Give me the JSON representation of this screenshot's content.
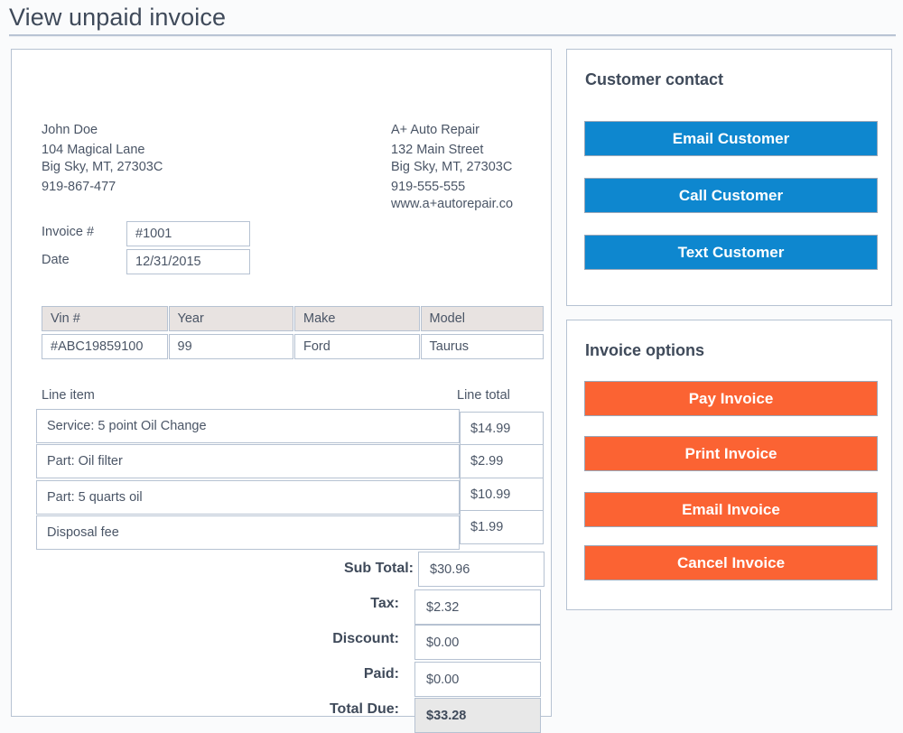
{
  "page": {
    "title": "View unpaid invoice"
  },
  "invoice": {
    "customer": {
      "name": "John Doe",
      "street": "104 Magical Lane",
      "city_state_zip": "Big Sky, MT, 27303C",
      "phone": "919-867-477"
    },
    "business": {
      "name": "A+ Auto Repair",
      "street": "132 Main Street",
      "city_state_zip": "Big Sky, MT, 27303C",
      "phone": "919-555-555",
      "website": "www.a+autorepair.co"
    },
    "meta": [
      {
        "label": "Invoice #",
        "value": "#1001"
      },
      {
        "label": "Date",
        "value": "12/31/2015"
      }
    ],
    "vehicle": {
      "headers": [
        "Vin #",
        "Year",
        "Make",
        "Model"
      ],
      "row": [
        "#ABC19859100",
        "99",
        "Ford",
        "Taurus"
      ]
    },
    "line_items": {
      "header_item": "Line item",
      "header_total": "Line total",
      "rows": [
        {
          "description": "Service: 5 point Oil Change",
          "amount": "$14.99"
        },
        {
          "description": "Part: Oil filter",
          "amount": "$2.99"
        },
        {
          "description": "Part: 5 quarts oil",
          "amount": "$10.99"
        },
        {
          "description": "Disposal fee",
          "amount": "$1.99"
        }
      ]
    },
    "totals": [
      {
        "label": "Sub Total:",
        "value": "$30.96"
      },
      {
        "label": "Tax:",
        "value": "$2.32"
      },
      {
        "label": "Discount:",
        "value": "$0.00"
      },
      {
        "label": "Paid:",
        "value": "$0.00"
      },
      {
        "label": "Total Due:",
        "value": "$33.28"
      }
    ]
  },
  "contact_panel": {
    "heading": "Customer contact",
    "buttons": [
      {
        "label": "Email Customer"
      },
      {
        "label": "Call Customer"
      },
      {
        "label": "Text Customer"
      }
    ]
  },
  "options_panel": {
    "heading": "Invoice options",
    "buttons": [
      {
        "label": "Pay Invoice"
      },
      {
        "label": "Print Invoice"
      },
      {
        "label": "Email Invoice"
      },
      {
        "label": "Cancel Invoice"
      }
    ]
  },
  "colors": {
    "contact_button": "#0e87cf",
    "option_button": "#fb6333",
    "border": "#b6c2d2",
    "table_header_bg": "#e8e3e1",
    "total_due_bg": "#e8e8e8",
    "text": "#3f4a5a",
    "page_bg": "#fafbfc"
  }
}
